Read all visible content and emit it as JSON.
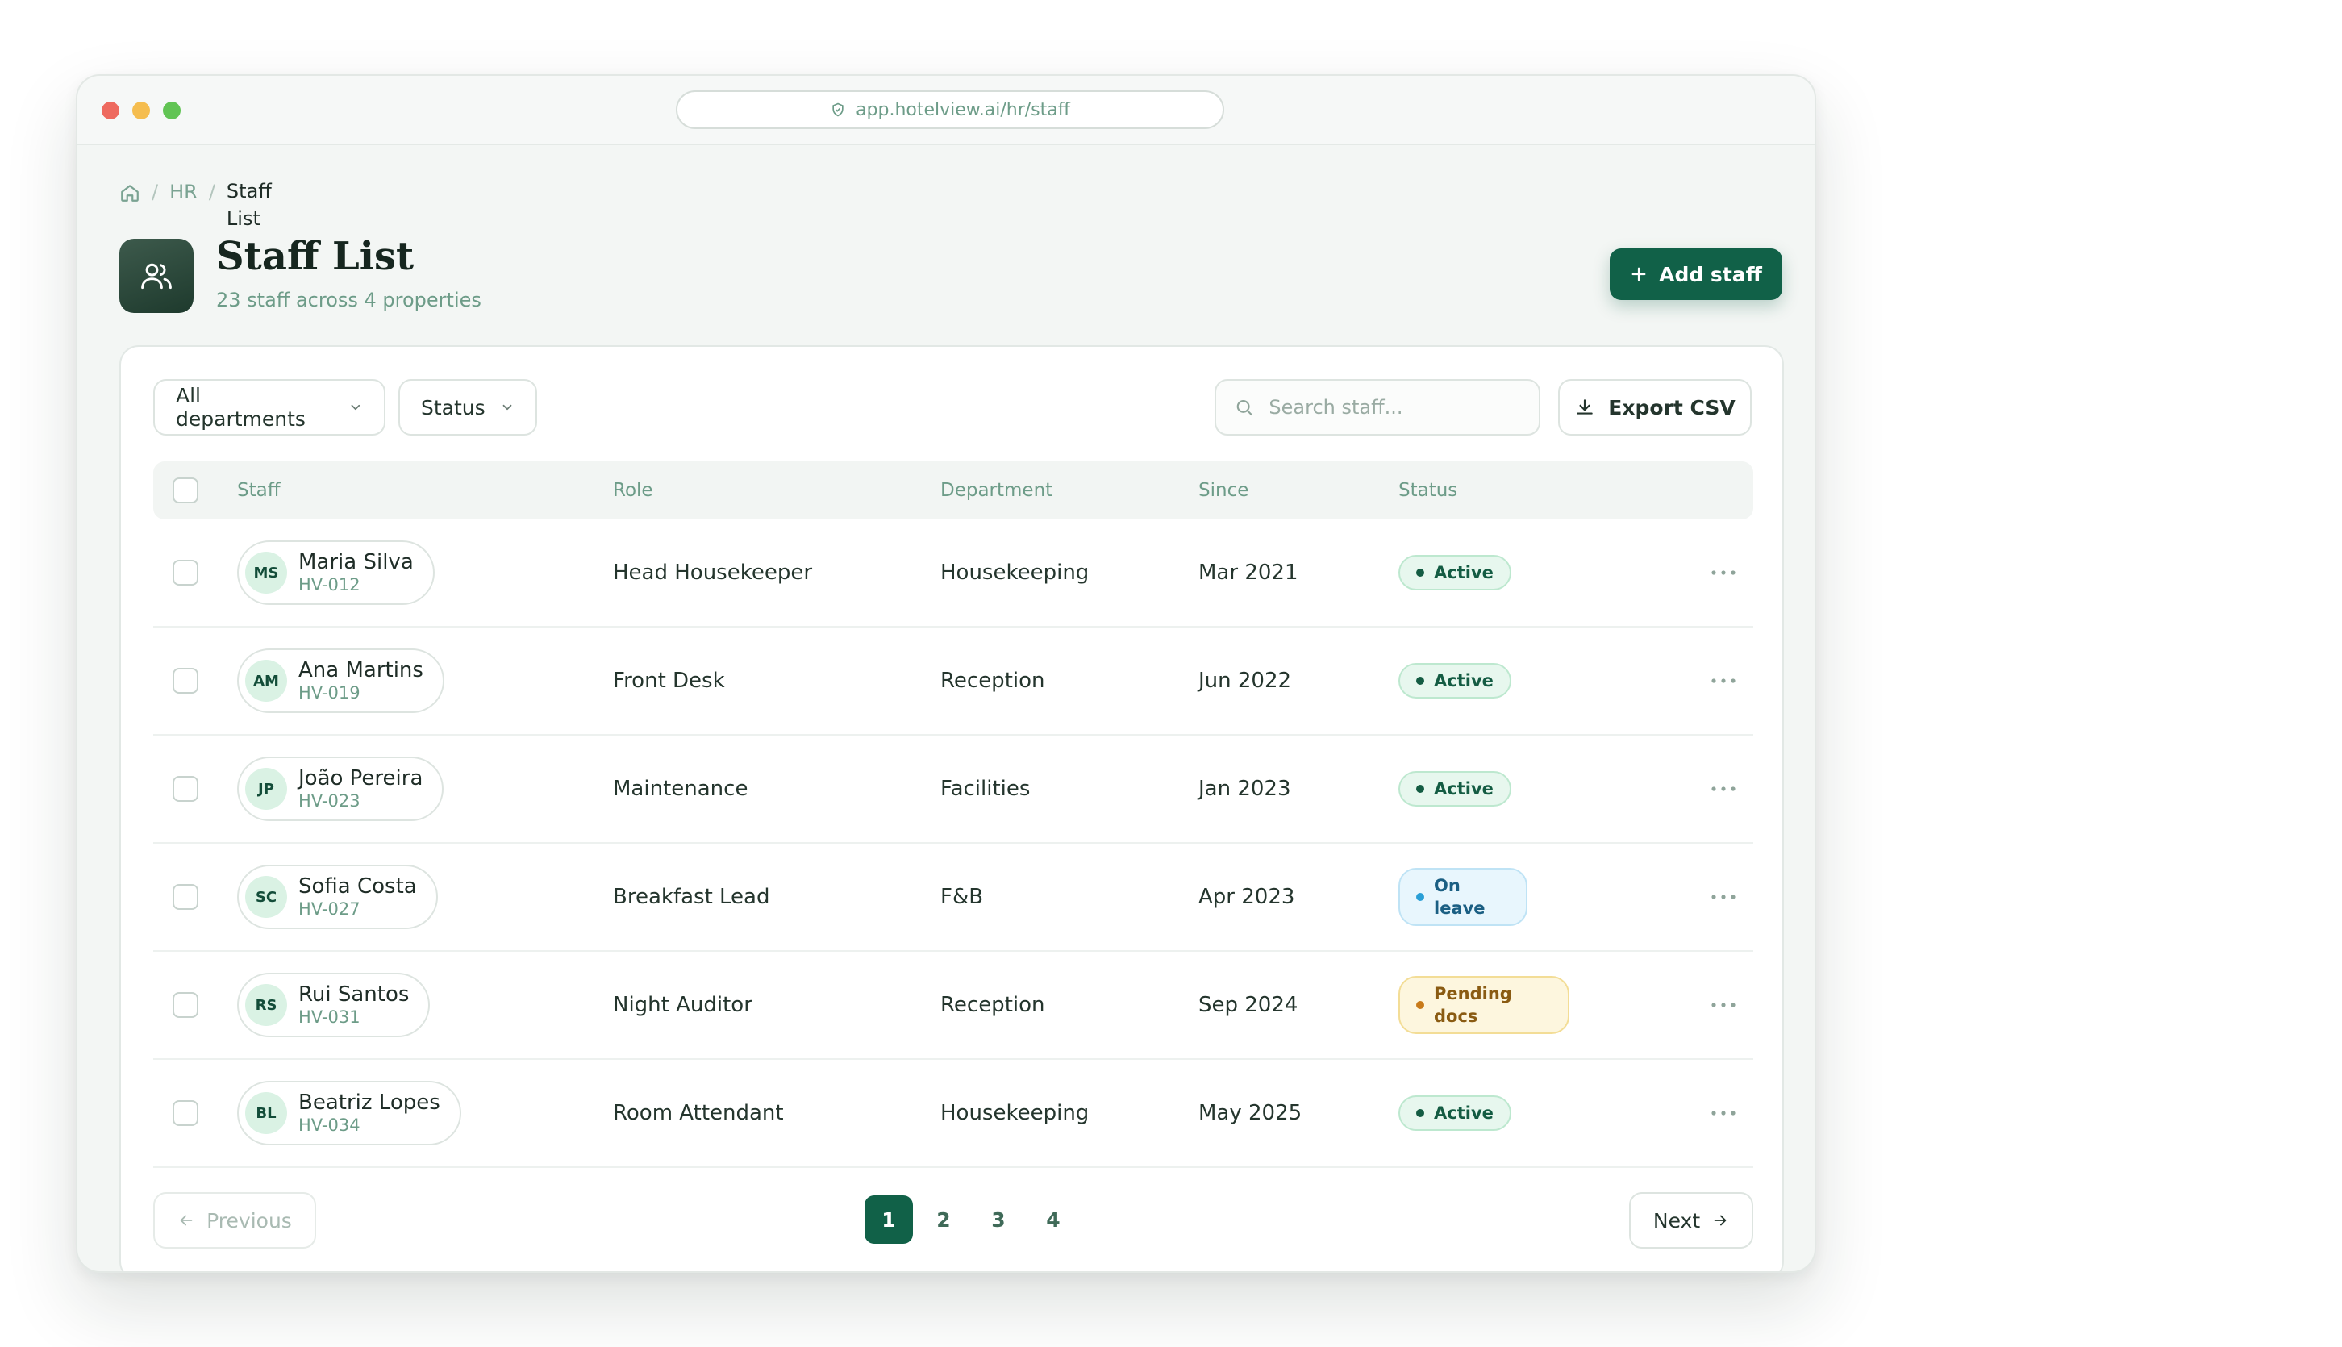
{
  "browser": {
    "url": "app.hotelview.ai/hr/staff"
  },
  "breadcrumb": {
    "section": "HR",
    "current": "Staff List"
  },
  "header": {
    "title": "Staff List",
    "subtitle": "23 staff across 4 properties",
    "add_label": "Add staff"
  },
  "filters": {
    "department": "All departments",
    "status": "Status"
  },
  "search": {
    "placeholder": "Search staff..."
  },
  "export_label": "Export CSV",
  "table": {
    "columns": [
      "Staff",
      "Role",
      "Department",
      "Since",
      "Status"
    ],
    "rows": [
      {
        "initials": "MS",
        "name": "Maria Silva",
        "id": "HV-012",
        "role": "Head Housekeeper",
        "department": "Housekeeping",
        "since": "Mar 2021",
        "status": "Active"
      },
      {
        "initials": "AM",
        "name": "Ana Martins",
        "id": "HV-019",
        "role": "Front Desk",
        "department": "Reception",
        "since": "Jun 2022",
        "status": "Active"
      },
      {
        "initials": "JP",
        "name": "João Pereira",
        "id": "HV-023",
        "role": "Maintenance",
        "department": "Facilities",
        "since": "Jan 2023",
        "status": "Active"
      },
      {
        "initials": "SC",
        "name": "Sofia Costa",
        "id": "HV-027",
        "role": "Breakfast Lead",
        "department": "F&B",
        "since": "Apr 2023",
        "status": "On leave"
      },
      {
        "initials": "RS",
        "name": "Rui Santos",
        "id": "HV-031",
        "role": "Night Auditor",
        "department": "Reception",
        "since": "Sep 2024",
        "status": "Pending docs"
      },
      {
        "initials": "BL",
        "name": "Beatriz Lopes",
        "id": "HV-034",
        "role": "Room Attendant",
        "department": "Housekeeping",
        "since": "May 2025",
        "status": "Active"
      }
    ]
  },
  "pagination": {
    "previous_label": "Previous",
    "next_label": "Next",
    "pages": [
      "1",
      "2",
      "3",
      "4"
    ],
    "current_page": "1"
  },
  "colors": {
    "accent": "#116148",
    "active": "#145c43",
    "on_leave": "#2a9fd6",
    "pending": "#c87a1a"
  }
}
